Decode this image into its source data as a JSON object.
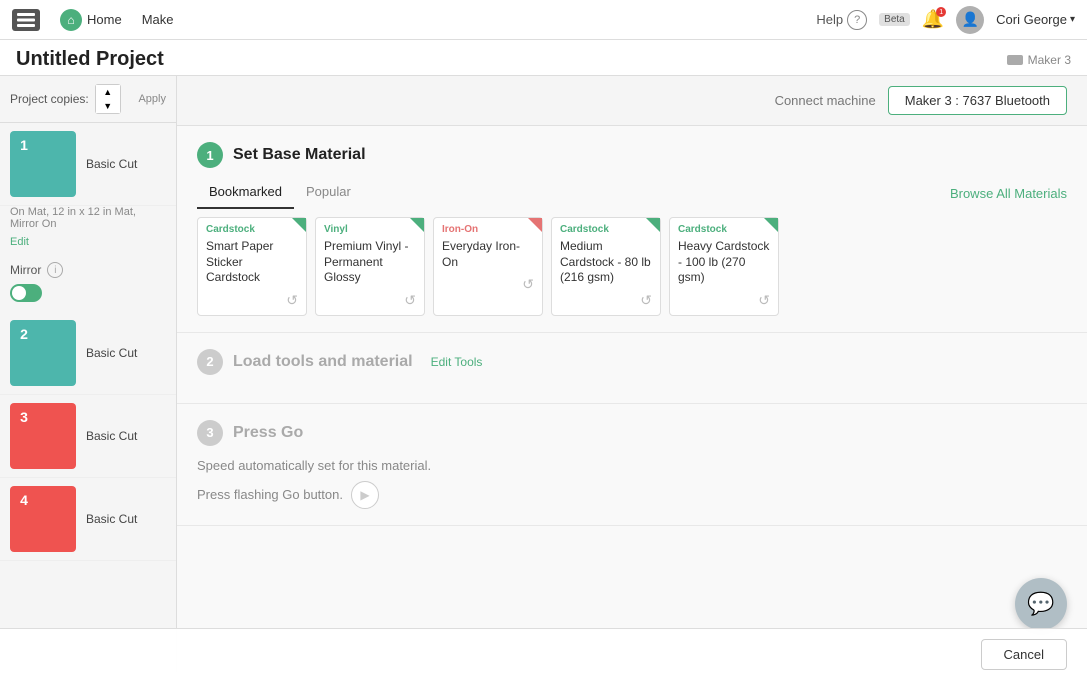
{
  "nav": {
    "home_label": "Home",
    "make_label": "Make",
    "help_label": "Help",
    "beta_label": "Beta",
    "notif_count": "1",
    "user_name": "Cori George",
    "machine_name": "Maker 3"
  },
  "page": {
    "title": "Untitled Project",
    "machine_label": "Maker 3"
  },
  "left_panel": {
    "copies_label": "Project copies:",
    "apply_label": "Apply",
    "mirror_label": "Mirror",
    "items": [
      {
        "id": 1,
        "label": "Basic Cut",
        "color": "#4db6ac",
        "desc": "On Mat, 12 in x 12 in Mat, Mirror On",
        "edit": "Edit"
      },
      {
        "id": 2,
        "label": "Basic Cut",
        "color": "#4db6ac",
        "desc": "",
        "edit": ""
      },
      {
        "id": 3,
        "label": "Basic Cut",
        "color": "#ef5350",
        "desc": "",
        "edit": ""
      },
      {
        "id": 4,
        "label": "Basic Cut",
        "color": "#ef5350",
        "desc": "",
        "edit": ""
      }
    ]
  },
  "connect_bar": {
    "label": "Connect machine",
    "btn_label": "Maker 3 : 7637 Bluetooth"
  },
  "steps": {
    "step1": {
      "num": "1",
      "title": "Set Base Material",
      "tabs": [
        "Bookmarked",
        "Popular"
      ],
      "active_tab": "Bookmarked",
      "browse_label": "Browse All Materials",
      "materials": [
        {
          "type": "Cardstock",
          "type_color": "green",
          "name": "Smart Paper Sticker Cardstock",
          "corner_color": "green"
        },
        {
          "type": "Vinyl",
          "type_color": "green",
          "name": "Premium Vinyl - Permanent Glossy",
          "corner_color": "green"
        },
        {
          "type": "Iron-On",
          "type_color": "red",
          "name": "Everyday Iron-On",
          "corner_color": "red"
        },
        {
          "type": "Cardstock",
          "type_color": "green",
          "name": "Medium Cardstock - 80 lb (216 gsm)",
          "corner_color": "green"
        },
        {
          "type": "Cardstock",
          "type_color": "green",
          "name": "Heavy Cardstock - 100 lb (270 gsm)",
          "corner_color": "green"
        }
      ]
    },
    "step2": {
      "num": "2",
      "title": "Load tools and material",
      "edit_label": "Edit Tools"
    },
    "step3": {
      "num": "3",
      "title": "Press Go",
      "desc": "Speed automatically set for this material.",
      "go_label": "Press flashing Go button."
    }
  },
  "cancel_bar": {
    "cancel_label": "Cancel"
  }
}
